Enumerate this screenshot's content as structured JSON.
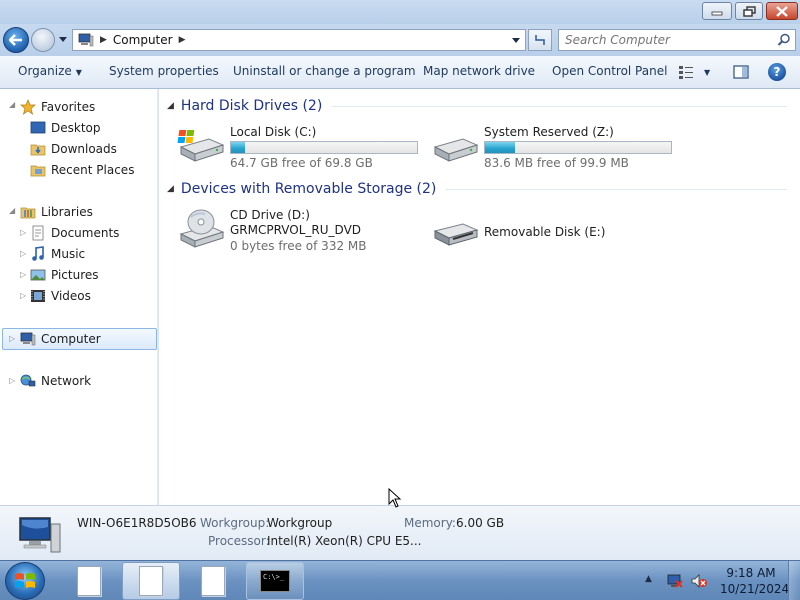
{
  "window": {
    "minimize_label": "minimize",
    "maximize_label": "restore",
    "close_label": "close"
  },
  "address": {
    "crumb": "Computer",
    "search_placeholder": "Search Computer"
  },
  "toolbar": {
    "organize": "Organize",
    "system_properties": "System properties",
    "uninstall": "Uninstall or change a program",
    "map_drive": "Map network drive",
    "control_panel": "Open Control Panel"
  },
  "nav": {
    "favorites": "Favorites",
    "desktop": "Desktop",
    "downloads": "Downloads",
    "recent_places": "Recent Places",
    "libraries": "Libraries",
    "documents": "Documents",
    "music": "Music",
    "pictures": "Pictures",
    "videos": "Videos",
    "computer": "Computer",
    "network": "Network"
  },
  "groups": {
    "hard_disks": "Hard Disk Drives (2)",
    "removable": "Devices with Removable Storage (2)"
  },
  "drives": {
    "c": {
      "name": "Local Disk (C:)",
      "free": "64.7 GB free of 69.8 GB",
      "used_fraction": 0.073
    },
    "z": {
      "name": "System Reserved (Z:)",
      "free": "83.6 MB free of 99.9 MB",
      "used_fraction": 0.163
    },
    "d": {
      "name": "CD Drive (D:)",
      "label": "GRMCPRVOL_RU_DVD",
      "free": "0 bytes free of 332 MB"
    },
    "e": {
      "name": "Removable Disk (E:)"
    }
  },
  "details": {
    "computer_name": "WIN-O6E1R8D5OB6",
    "workgroup_label": "Workgroup:",
    "workgroup_value": "Workgroup",
    "memory_label": "Memory:",
    "memory_value": "6.00 GB",
    "processor_label": "Processor:",
    "processor_value": "Intel(R) Xeon(R) CPU E5..."
  },
  "taskbar": {
    "time": "9:18 AM",
    "date": "10/21/2024",
    "cmd_text": "C:\\>_"
  },
  "colors": {
    "accent": "#1e3287",
    "bar_fill": "#27a3cf",
    "selection": "#dceafb"
  }
}
